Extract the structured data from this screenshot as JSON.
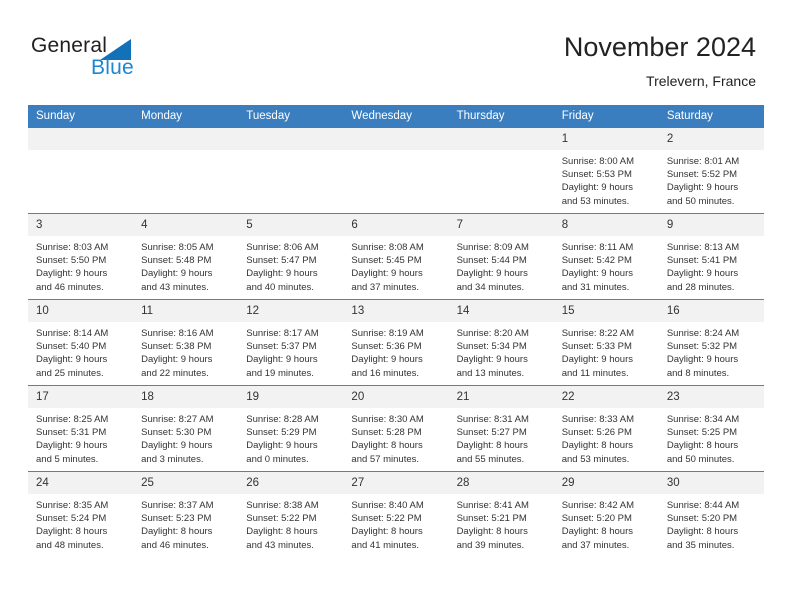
{
  "brand": {
    "name_part1": "General",
    "name_part2": "Blue",
    "triangle_color": "#1271b8",
    "blue_color": "#1b87d4"
  },
  "header": {
    "month_year": "November 2024",
    "location": "Trelevern, France",
    "header_bg_color": "#3a7ebf"
  },
  "weekday_headers": [
    "Sunday",
    "Monday",
    "Tuesday",
    "Wednesday",
    "Thursday",
    "Friday",
    "Saturday"
  ],
  "weeks": [
    [
      {
        "day": "",
        "empty": true,
        "lines": []
      },
      {
        "day": "",
        "empty": true,
        "lines": []
      },
      {
        "day": "",
        "empty": true,
        "lines": []
      },
      {
        "day": "",
        "empty": true,
        "lines": []
      },
      {
        "day": "",
        "empty": true,
        "lines": []
      },
      {
        "day": "1",
        "empty": false,
        "lines": [
          "Sunrise: 8:00 AM",
          "Sunset: 5:53 PM",
          "Daylight: 9 hours",
          "and 53 minutes."
        ]
      },
      {
        "day": "2",
        "empty": false,
        "lines": [
          "Sunrise: 8:01 AM",
          "Sunset: 5:52 PM",
          "Daylight: 9 hours",
          "and 50 minutes."
        ]
      }
    ],
    [
      {
        "day": "3",
        "empty": false,
        "lines": [
          "Sunrise: 8:03 AM",
          "Sunset: 5:50 PM",
          "Daylight: 9 hours",
          "and 46 minutes."
        ]
      },
      {
        "day": "4",
        "empty": false,
        "lines": [
          "Sunrise: 8:05 AM",
          "Sunset: 5:48 PM",
          "Daylight: 9 hours",
          "and 43 minutes."
        ]
      },
      {
        "day": "5",
        "empty": false,
        "lines": [
          "Sunrise: 8:06 AM",
          "Sunset: 5:47 PM",
          "Daylight: 9 hours",
          "and 40 minutes."
        ]
      },
      {
        "day": "6",
        "empty": false,
        "lines": [
          "Sunrise: 8:08 AM",
          "Sunset: 5:45 PM",
          "Daylight: 9 hours",
          "and 37 minutes."
        ]
      },
      {
        "day": "7",
        "empty": false,
        "lines": [
          "Sunrise: 8:09 AM",
          "Sunset: 5:44 PM",
          "Daylight: 9 hours",
          "and 34 minutes."
        ]
      },
      {
        "day": "8",
        "empty": false,
        "lines": [
          "Sunrise: 8:11 AM",
          "Sunset: 5:42 PM",
          "Daylight: 9 hours",
          "and 31 minutes."
        ]
      },
      {
        "day": "9",
        "empty": false,
        "lines": [
          "Sunrise: 8:13 AM",
          "Sunset: 5:41 PM",
          "Daylight: 9 hours",
          "and 28 minutes."
        ]
      }
    ],
    [
      {
        "day": "10",
        "empty": false,
        "lines": [
          "Sunrise: 8:14 AM",
          "Sunset: 5:40 PM",
          "Daylight: 9 hours",
          "and 25 minutes."
        ]
      },
      {
        "day": "11",
        "empty": false,
        "lines": [
          "Sunrise: 8:16 AM",
          "Sunset: 5:38 PM",
          "Daylight: 9 hours",
          "and 22 minutes."
        ]
      },
      {
        "day": "12",
        "empty": false,
        "lines": [
          "Sunrise: 8:17 AM",
          "Sunset: 5:37 PM",
          "Daylight: 9 hours",
          "and 19 minutes."
        ]
      },
      {
        "day": "13",
        "empty": false,
        "lines": [
          "Sunrise: 8:19 AM",
          "Sunset: 5:36 PM",
          "Daylight: 9 hours",
          "and 16 minutes."
        ]
      },
      {
        "day": "14",
        "empty": false,
        "lines": [
          "Sunrise: 8:20 AM",
          "Sunset: 5:34 PM",
          "Daylight: 9 hours",
          "and 13 minutes."
        ]
      },
      {
        "day": "15",
        "empty": false,
        "lines": [
          "Sunrise: 8:22 AM",
          "Sunset: 5:33 PM",
          "Daylight: 9 hours",
          "and 11 minutes."
        ]
      },
      {
        "day": "16",
        "empty": false,
        "lines": [
          "Sunrise: 8:24 AM",
          "Sunset: 5:32 PM",
          "Daylight: 9 hours",
          "and 8 minutes."
        ]
      }
    ],
    [
      {
        "day": "17",
        "empty": false,
        "lines": [
          "Sunrise: 8:25 AM",
          "Sunset: 5:31 PM",
          "Daylight: 9 hours",
          "and 5 minutes."
        ]
      },
      {
        "day": "18",
        "empty": false,
        "lines": [
          "Sunrise: 8:27 AM",
          "Sunset: 5:30 PM",
          "Daylight: 9 hours",
          "and 3 minutes."
        ]
      },
      {
        "day": "19",
        "empty": false,
        "lines": [
          "Sunrise: 8:28 AM",
          "Sunset: 5:29 PM",
          "Daylight: 9 hours",
          "and 0 minutes."
        ]
      },
      {
        "day": "20",
        "empty": false,
        "lines": [
          "Sunrise: 8:30 AM",
          "Sunset: 5:28 PM",
          "Daylight: 8 hours",
          "and 57 minutes."
        ]
      },
      {
        "day": "21",
        "empty": false,
        "lines": [
          "Sunrise: 8:31 AM",
          "Sunset: 5:27 PM",
          "Daylight: 8 hours",
          "and 55 minutes."
        ]
      },
      {
        "day": "22",
        "empty": false,
        "lines": [
          "Sunrise: 8:33 AM",
          "Sunset: 5:26 PM",
          "Daylight: 8 hours",
          "and 53 minutes."
        ]
      },
      {
        "day": "23",
        "empty": false,
        "lines": [
          "Sunrise: 8:34 AM",
          "Sunset: 5:25 PM",
          "Daylight: 8 hours",
          "and 50 minutes."
        ]
      }
    ],
    [
      {
        "day": "24",
        "empty": false,
        "lines": [
          "Sunrise: 8:35 AM",
          "Sunset: 5:24 PM",
          "Daylight: 8 hours",
          "and 48 minutes."
        ]
      },
      {
        "day": "25",
        "empty": false,
        "lines": [
          "Sunrise: 8:37 AM",
          "Sunset: 5:23 PM",
          "Daylight: 8 hours",
          "and 46 minutes."
        ]
      },
      {
        "day": "26",
        "empty": false,
        "lines": [
          "Sunrise: 8:38 AM",
          "Sunset: 5:22 PM",
          "Daylight: 8 hours",
          "and 43 minutes."
        ]
      },
      {
        "day": "27",
        "empty": false,
        "lines": [
          "Sunrise: 8:40 AM",
          "Sunset: 5:22 PM",
          "Daylight: 8 hours",
          "and 41 minutes."
        ]
      },
      {
        "day": "28",
        "empty": false,
        "lines": [
          "Sunrise: 8:41 AM",
          "Sunset: 5:21 PM",
          "Daylight: 8 hours",
          "and 39 minutes."
        ]
      },
      {
        "day": "29",
        "empty": false,
        "lines": [
          "Sunrise: 8:42 AM",
          "Sunset: 5:20 PM",
          "Daylight: 8 hours",
          "and 37 minutes."
        ]
      },
      {
        "day": "30",
        "empty": false,
        "lines": [
          "Sunrise: 8:44 AM",
          "Sunset: 5:20 PM",
          "Daylight: 8 hours",
          "and 35 minutes."
        ]
      }
    ]
  ]
}
